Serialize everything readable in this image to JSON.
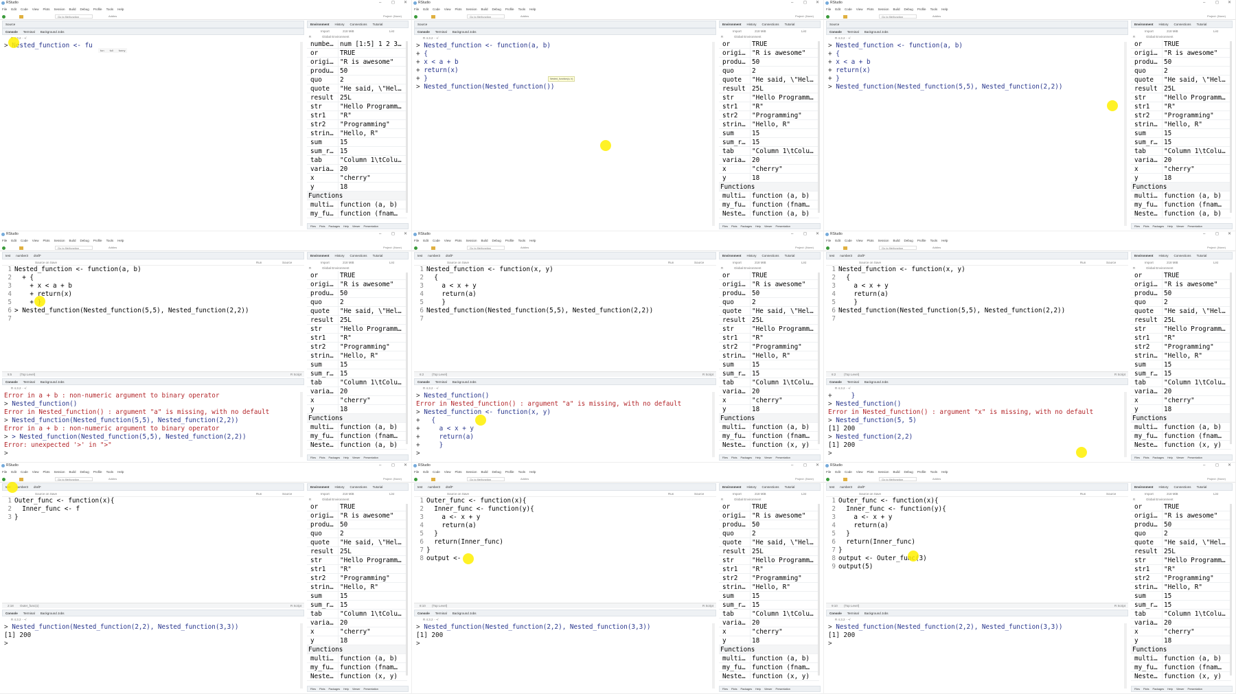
{
  "app": {
    "title": "RStudio",
    "menu": [
      "File",
      "Edit",
      "Code",
      "View",
      "Plots",
      "Session",
      "Build",
      "Debug",
      "Profile",
      "Tools",
      "Help"
    ],
    "goto": "Go to file/function",
    "addins": "Addins",
    "project": "Project: (None)"
  },
  "source_label": "Source",
  "source_tabs": [
    "test",
    "number3",
    "draft*"
  ],
  "editor_toolbar": {
    "source_on_save": "Source on Save",
    "run": "Run",
    "source": "Source",
    "file_type": "R Script"
  },
  "console_tabs": [
    "Console",
    "Terminal",
    "Background Jobs"
  ],
  "r_version": "R 4.3.2 · ~/",
  "env": {
    "tabs": [
      "Environment",
      "History",
      "Connections",
      "Tutorial"
    ],
    "import": "Import",
    "memory": "218 MiB",
    "list": "List",
    "lang": "R",
    "scope": "Global Environment",
    "variables": [
      [
        "or",
        "TRUE"
      ],
      [
        "origi…",
        "\"R is awesome\""
      ],
      [
        "produ…",
        "50"
      ],
      [
        "quo",
        "2"
      ],
      [
        "quote",
        "\"He said, \\\"Hel…"
      ],
      [
        "result",
        "25L"
      ],
      [
        "str",
        "\"Hello Programm…"
      ],
      [
        "str1",
        "\"R\""
      ],
      [
        "str2",
        "\"Programming\""
      ],
      [
        "strin…",
        "\"Hello, R\""
      ],
      [
        "sum",
        "15"
      ],
      [
        "sum_r…",
        "15"
      ],
      [
        "tab",
        "\"Column 1\\tColu…"
      ],
      [
        "varia…",
        "20"
      ],
      [
        "x",
        "\"cherry\""
      ],
      [
        "y",
        "18"
      ]
    ],
    "functions_label": "Functions",
    "functions": [
      [
        "multi…",
        "function (a, b)"
      ],
      [
        "my_fu…",
        "function (fnam…"
      ]
    ]
  },
  "bottom_tabs": [
    "Files",
    "Plots",
    "Packages",
    "Help",
    "Viewer",
    "Presentation"
  ],
  "colors": {
    "command": "#26348c",
    "error": "#b3262a",
    "highlight": "#fff000"
  },
  "panels": [
    {
      "env_first": [
        "numbe…",
        "num [1:5] 1 2 3…"
      ],
      "env_last": null,
      "console": [
        [
          ">",
          "Nested_function <- fu",
          "cmd"
        ]
      ],
      "autocomplete": [
        "fun",
        "full",
        "funny"
      ]
    },
    {
      "env_first": null,
      "env_last": [
        "Neste…",
        "function (a, b)"
      ],
      "tooltip": "Nested_function(a, b)",
      "console": [
        [
          ">",
          "Nested_function <- function(a, b)",
          "cmd"
        ],
        [
          "+",
          "{",
          "cmd"
        ],
        [
          "+",
          "x < a + b",
          "cmd"
        ],
        [
          "+",
          "return(x)",
          "cmd"
        ],
        [
          "+",
          "}",
          "cmd"
        ],
        [
          ">",
          "Nested_function(Nested_function())",
          "cmd"
        ]
      ]
    },
    {
      "env_first": null,
      "env_last": [
        "Neste…",
        "function (a, b)"
      ],
      "console": [
        [
          ">",
          "Nested_function <- function(a, b)",
          "cmd"
        ],
        [
          "+",
          "{",
          "cmd"
        ],
        [
          "+",
          "x < a + b",
          "cmd"
        ],
        [
          "+",
          "return(x)",
          "cmd"
        ],
        [
          "+",
          "}",
          "cmd"
        ],
        [
          ">",
          "Nested_function(Nested_function(5,5), Nested_function(2,2))",
          "cmd"
        ]
      ]
    },
    {
      "env_first": null,
      "env_last": [
        "Neste…",
        "function (a, b)"
      ],
      "source": [
        "Nested_function <- function(a, b)",
        "  + {",
        "    + x < a + b",
        "    + return(x)",
        "    + }",
        "> Nested_function(Nested_function(5,5), Nested_function(2,2))",
        ""
      ],
      "position": "5:5",
      "scope": "(Top Level)",
      "console": [
        [
          "",
          "Error in a + b : non-numeric argument to binary operator",
          "err"
        ],
        [
          ">",
          "Nested_function()",
          "cmd"
        ],
        [
          "",
          "Error in Nested_function() : argument \"a\" is missing, with no default",
          "err"
        ],
        [
          ">",
          "Nested_function(Nested_function(5,5), Nested_function(2,2))",
          "cmd"
        ],
        [
          "",
          "Error in a + b : non-numeric argument to binary operator",
          "err"
        ],
        [
          ">",
          "> Nested_function(Nested_function(5,5), Nested_function(2,2))",
          "cmd"
        ],
        [
          "",
          "Error: unexpected '>' in \">\"",
          "err"
        ],
        [
          ">",
          "",
          "cmd"
        ]
      ]
    },
    {
      "env_first": null,
      "env_last": [
        "Neste…",
        "function (x, y)"
      ],
      "source": [
        "Nested_function <- function(x, y)",
        "  {",
        "    a < x + y",
        "    return(a)",
        "    }",
        "Nested_function(Nested_function(5,5), Nested_function(2,2))",
        ""
      ],
      "position": "6:2",
      "scope": "(Top Level)",
      "console": [
        [
          ">",
          "Nested_function()",
          "cmd"
        ],
        [
          "",
          "Error in Nested_function() : argument \"a\" is missing, with no default",
          "err"
        ],
        [
          ">",
          "Nested_function <- function(x, y)",
          "cmd"
        ],
        [
          "+",
          "  {",
          "cmd"
        ],
        [
          "+",
          "    a < x + y",
          "cmd"
        ],
        [
          "+",
          "    return(a)",
          "cmd"
        ],
        [
          "+",
          "    }",
          "cmd"
        ],
        [
          ">",
          "",
          "cmd"
        ]
      ]
    },
    {
      "env_first": null,
      "env_last": [
        "Neste…",
        "function (x, y)"
      ],
      "source": [
        "Nested_function <- function(x, y)",
        "  {",
        "    a < x + y",
        "    return(a)",
        "    }",
        "Nested_function(Nested_function(5,5), Nested_function(2,2))",
        ""
      ],
      "position": "6:2",
      "scope": "(Top Level)",
      "console": [
        [
          "+",
          "    }",
          "cmd"
        ],
        [
          ">",
          "Nested_function()",
          "cmd"
        ],
        [
          "",
          "Error in Nested_function() : argument \"x\" is missing, with no default",
          "err"
        ],
        [
          ">",
          "Nested_function(5, 5)",
          "cmd"
        ],
        [
          "",
          "[1] 200",
          "out"
        ],
        [
          ">",
          "Nested_function(2,2)",
          "cmd"
        ],
        [
          "",
          "[1] 200",
          "out"
        ],
        [
          ">",
          "",
          "cmd"
        ]
      ]
    },
    {
      "env_first": null,
      "env_last": [
        "Neste…",
        "function (x, y)"
      ],
      "source": [
        "Outer_func <- function(x){",
        "  Inner_func <- f",
        "}"
      ],
      "position": "2:18",
      "scope": "Outer_func(x)",
      "console": [
        [
          ">",
          "Nested_function(Nested_function(2,2), Nested_function(3,3))",
          "cmd"
        ],
        [
          "",
          "[1] 200",
          "out"
        ],
        [
          ">",
          "",
          "cmd"
        ]
      ]
    },
    {
      "env_first": null,
      "env_last": [
        "Neste…",
        "function (x, y)"
      ],
      "source": [
        "Outer_func <- function(x){",
        "  Inner_func <- function(y){",
        "    a <- x + y",
        "    return(a)",
        "  }",
        "  return(Inner_func)",
        "}",
        "output <-"
      ],
      "position": "8:10",
      "scope": "(Top Level)",
      "console": [
        [
          ">",
          "Nested_function(Nested_function(2,2), Nested_function(3,3))",
          "cmd"
        ],
        [
          "",
          "[1] 200",
          "out"
        ],
        [
          ">",
          "",
          "cmd"
        ]
      ]
    },
    {
      "env_first": null,
      "env_last": [
        "Neste…",
        "function (x, y)"
      ],
      "source": [
        "Outer_func <- function(x){",
        "  Inner_func <- function(y){",
        "    a <- x + y",
        "    return(a)",
        "  }",
        "  return(Inner_func)",
        "}",
        "output <- Outer_func(3)",
        "output(5)"
      ],
      "position": "9:10",
      "scope": "(Top Level)",
      "console": [
        [
          ">",
          "Nested_function(Nested_function(2,2), Nested_function(3,3))",
          "cmd"
        ],
        [
          "",
          "[1] 200",
          "out"
        ],
        [
          ">",
          "",
          "cmd"
        ]
      ]
    }
  ]
}
